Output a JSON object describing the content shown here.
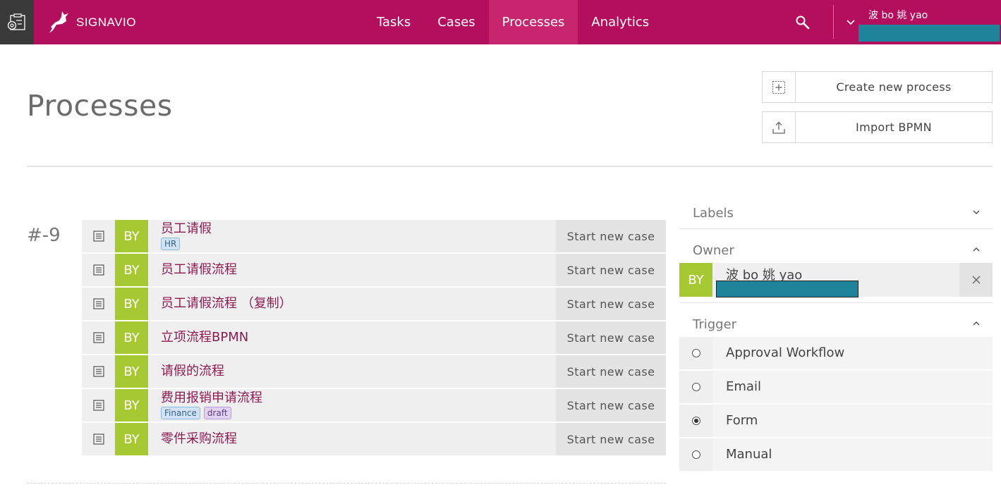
{
  "header": {
    "brand": "SIGNAVIO",
    "nav": [
      {
        "label": "Tasks",
        "active": false
      },
      {
        "label": "Cases",
        "active": false
      },
      {
        "label": "Processes",
        "active": true
      },
      {
        "label": "Analytics",
        "active": false
      }
    ],
    "user_name": "波 bo 姚 yao",
    "colors": {
      "brand": "#b30f5e",
      "active_tab": "#c8256f",
      "redaction": "#1f8499"
    }
  },
  "page": {
    "title": "Processes",
    "create_label": "Create new process",
    "import_label": "Import BPMN"
  },
  "group": {
    "label": "#-9",
    "processes": [
      {
        "avatar": "BY",
        "name": "员工请假",
        "tags": [
          {
            "text": "HR",
            "color": "blue"
          }
        ],
        "action": "Start new case"
      },
      {
        "avatar": "BY",
        "name": "员工请假流程",
        "tags": [],
        "action": "Start new case"
      },
      {
        "avatar": "BY",
        "name": "员工请假流程 （复制）",
        "tags": [],
        "action": "Start new case"
      },
      {
        "avatar": "BY",
        "name": "立项流程BPMN",
        "tags": [],
        "action": "Start new case"
      },
      {
        "avatar": "BY",
        "name": "请假的流程",
        "tags": [],
        "action": "Start new case"
      },
      {
        "avatar": "BY",
        "name": "费用报销申请流程",
        "tags": [
          {
            "text": "Finance",
            "color": "blue"
          },
          {
            "text": "draft",
            "color": "purple"
          }
        ],
        "action": "Start new case"
      },
      {
        "avatar": "BY",
        "name": "零件采购流程",
        "tags": [],
        "action": "Start new case"
      }
    ]
  },
  "sidebar": {
    "labels_title": "Labels",
    "owner_title": "Owner",
    "owner": {
      "avatar": "BY",
      "name": "波 bo 姚 yao"
    },
    "trigger_title": "Trigger",
    "triggers": [
      {
        "label": "Approval Workflow",
        "selected": false
      },
      {
        "label": "Email",
        "selected": false
      },
      {
        "label": "Form",
        "selected": true
      },
      {
        "label": "Manual",
        "selected": false
      }
    ],
    "avatar_color": "#a6c832",
    "link_color": "#8c1b52"
  }
}
